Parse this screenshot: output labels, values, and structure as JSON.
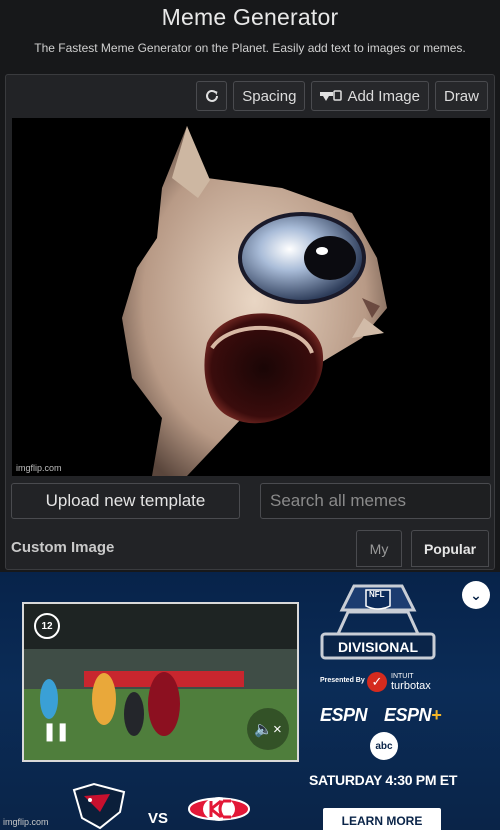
{
  "header": {
    "title": "Meme Generator",
    "subtitle": "The Fastest Meme Generator on the Planet. Easily add text to images or memes."
  },
  "toolbar": {
    "rotate_icon": "rotate-icon",
    "spacing_label": "Spacing",
    "add_image_label": "Add Image",
    "add_image_icon": "add-image-icon",
    "draw_label": "Draw"
  },
  "canvas": {
    "watermark": "imgflip.com"
  },
  "actions": {
    "upload_label": "Upload new template",
    "search_placeholder": "Search all memes"
  },
  "templates": {
    "section_label": "Custom Image",
    "tabs": [
      {
        "label": "My"
      },
      {
        "label": "Popular"
      }
    ]
  },
  "ad": {
    "replay_count": "12",
    "league": "NFL",
    "round": "DIVISIONAL",
    "presented_by": "Presented By",
    "sponsor_line1": "INTUIT",
    "sponsor_line2": "turbotax",
    "network1": "ESPN",
    "network2": "ESPN",
    "network2_plus": "+",
    "network3": "abc",
    "game_time": "SATURDAY 4:30 PM ET",
    "cta": "LEARN MORE",
    "vs": "VS",
    "watermark": "imgflip.com",
    "colors": {
      "background": "#0b2c57",
      "accent_red": "#d52b1e",
      "plus_yellow": "#f6b626"
    }
  }
}
